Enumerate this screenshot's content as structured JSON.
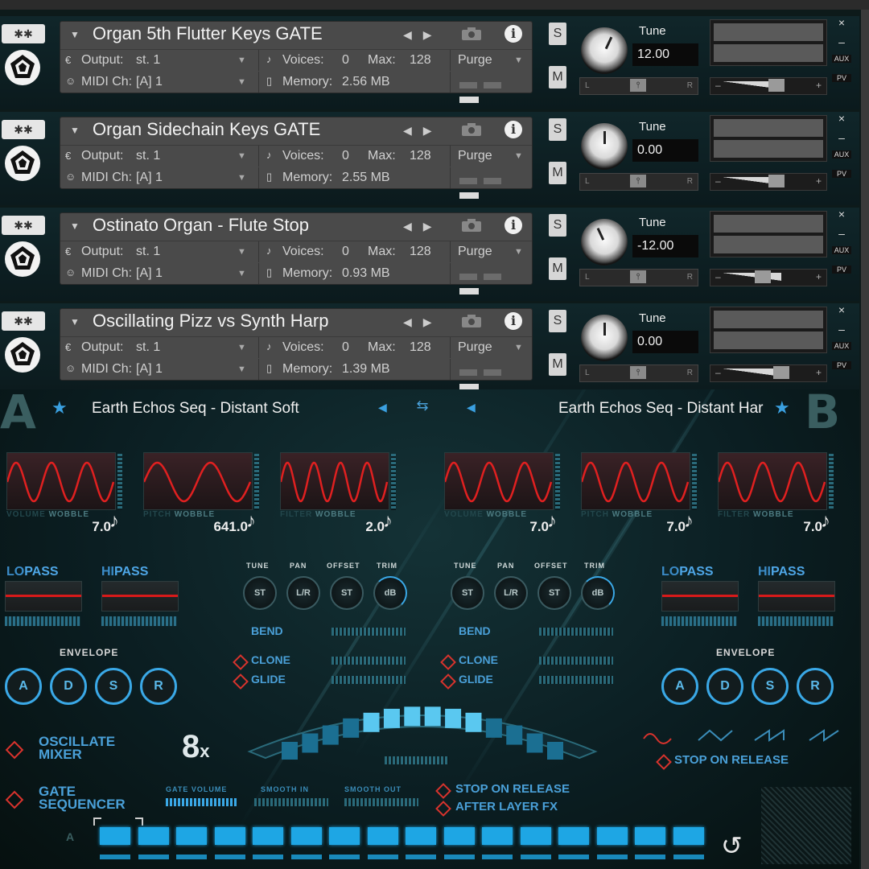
{
  "instruments": [
    {
      "name": "Organ 5th Flutter Keys GATE",
      "output_label": "Output:",
      "output": "st. 1",
      "voices_label": "Voices:",
      "voices": "0",
      "max_label": "Max:",
      "max": "128",
      "purge": "Purge",
      "midi_label": "MIDI Ch:",
      "midi": "[A]  1",
      "memory_label": "Memory:",
      "memory": "2.56 MB",
      "tune_label": "Tune",
      "tune": "12.00",
      "knob_angle": 25,
      "vol_pos": 0.5,
      "solo": "S",
      "mute": "M"
    },
    {
      "name": "Organ Sidechain Keys GATE",
      "output_label": "Output:",
      "output": "st. 1",
      "voices_label": "Voices:",
      "voices": "0",
      "max_label": "Max:",
      "max": "128",
      "purge": "Purge",
      "midi_label": "MIDI Ch:",
      "midi": "[A]  1",
      "memory_label": "Memory:",
      "memory": "2.55 MB",
      "tune_label": "Tune",
      "tune": "0.00",
      "knob_angle": 0,
      "vol_pos": 0.5,
      "solo": "S",
      "mute": "M"
    },
    {
      "name": "Ostinato Organ - Flute Stop",
      "output_label": "Output:",
      "output": "st. 1",
      "voices_label": "Voices:",
      "voices": "0",
      "max_label": "Max:",
      "max": "128",
      "purge": "Purge",
      "midi_label": "MIDI Ch:",
      "midi": "[A]  1",
      "memory_label": "Memory:",
      "memory": "0.93 MB",
      "tune_label": "Tune",
      "tune": "-12.00",
      "knob_angle": -25,
      "vol_pos": 0.35,
      "solo": "S",
      "mute": "M"
    },
    {
      "name": "Oscillating Pizz vs Synth Harp",
      "output_label": "Output:",
      "output": "st. 1",
      "voices_label": "Voices:",
      "voices": "0",
      "max_label": "Max:",
      "max": "128",
      "purge": "Purge",
      "midi_label": "MIDI Ch:",
      "midi": "[A]  1",
      "memory_label": "Memory:",
      "memory": "1.39 MB",
      "tune_label": "Tune",
      "tune": "0.00",
      "knob_angle": 0,
      "vol_pos": 0.55,
      "solo": "S",
      "mute": "M"
    }
  ],
  "side": {
    "close": "×",
    "minus": "–",
    "aux": "AUX",
    "pv": "PV"
  },
  "pan": {
    "left": "L",
    "right": "R",
    "center": "⫯"
  },
  "vol": {
    "minus": "–",
    "plus": "+"
  },
  "synth": {
    "letter_a": "A",
    "letter_b": "B",
    "preset_a": "Earth Echos Seq - Distant Soft",
    "preset_b": "Earth Echos Seq - Distant Har",
    "wobbles": [
      {
        "label_dim": "VOLUME",
        "label": "WOBBLE",
        "value": "7.0",
        "cycles": 3
      },
      {
        "label_dim": "PITCH",
        "label": "WOBBLE",
        "value": "641.0",
        "cycles": 2
      },
      {
        "label_dim": "FILTER",
        "label": "WOBBLE",
        "value": "2.0",
        "cycles": 4
      },
      {
        "label_dim": "VOLUME",
        "label": "WOBBLE",
        "value": "7.0",
        "cycles": 3
      },
      {
        "label_dim": "PITCH",
        "label": "WOBBLE",
        "value": "7.0",
        "cycles": 3
      },
      {
        "label_dim": "FILTER",
        "label": "WOBBLE",
        "value": "7.0",
        "cycles": 3
      }
    ],
    "lopass_a": "LO",
    "lopass_b": "PASS",
    "hipass_a": "HI",
    "hipass_b": "PASS",
    "envelope": "ENVELOPE",
    "env_knobs": [
      "A",
      "D",
      "S",
      "R"
    ],
    "small_labels": [
      "TUNE",
      "PAN",
      "OFFSET",
      "TRIM"
    ],
    "small_knobs": [
      "ST",
      "L/R",
      "ST",
      "dB"
    ],
    "bend": "BEND",
    "clone": "CLONE",
    "glide": "GLIDE",
    "oscillate_mixer": [
      "OSCILLATE",
      "MIXER"
    ],
    "gate_sequencer": [
      "GATE",
      "SEQUENCER"
    ],
    "multiplier": "8",
    "multiplier_x": "x",
    "gate_volume": "GATE VOLUME",
    "smooth_in": "SMOOTH IN",
    "smooth_out": "SMOOTH OUT",
    "stop_on_release": "STOP ON RELEASE",
    "after_layer_fx": "AFTER LAYER FX",
    "stop_on_release_b": "STOP ON RELEASE",
    "seq_marker": "A",
    "steps": 16
  },
  "colors": {
    "accent": "#3aa8e6",
    "wave": "#e02020",
    "diamond": "#d8332d"
  }
}
